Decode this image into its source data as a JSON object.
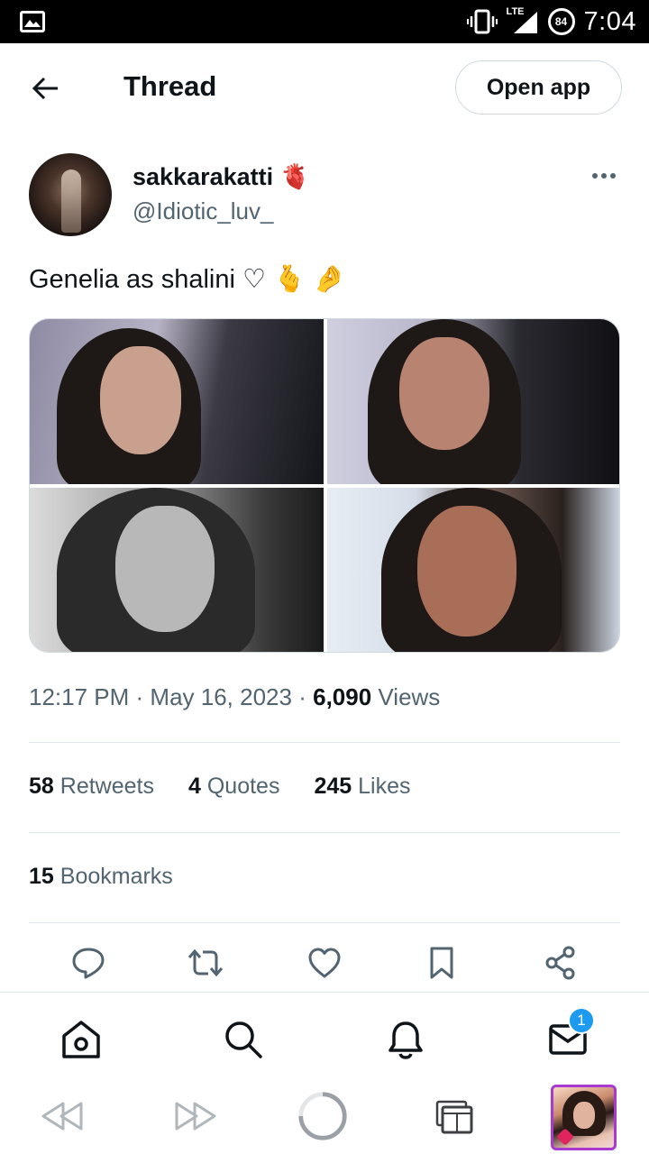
{
  "status_bar": {
    "network": "LTE",
    "battery": "84",
    "time": "7:04"
  },
  "header": {
    "title": "Thread",
    "open_app_label": "Open app"
  },
  "author": {
    "name": "sakkarakatti 🫀",
    "handle": "@Idiotic_luv_"
  },
  "tweet": {
    "text": "Genelia as shalini ♡ 🫰 🤌",
    "time": "12:17 PM",
    "date": "May 16, 2023",
    "views_count": "6,090",
    "views_label": "Views",
    "media_count": 4
  },
  "stats": {
    "retweets_count": "58",
    "retweets_label": "Retweets",
    "quotes_count": "4",
    "quotes_label": "Quotes",
    "likes_count": "245",
    "likes_label": "Likes",
    "bookmarks_count": "15",
    "bookmarks_label": "Bookmarks"
  },
  "actions": [
    "reply-icon",
    "retweet-icon",
    "like-icon",
    "bookmark-icon",
    "share-icon"
  ],
  "bottom_nav": {
    "items": [
      "home-icon",
      "search-icon",
      "notifications-icon",
      "messages-icon"
    ],
    "messages_badge": "1"
  },
  "browser_bar": {
    "items": [
      "back-icon",
      "forward-icon",
      "reload-icon",
      "tabs-icon"
    ]
  },
  "colors": {
    "text": "#0f1419",
    "secondary": "#536471",
    "border": "#cfd9de",
    "accent": "#1d9bf0",
    "thumb_border": "#a93ad1"
  }
}
